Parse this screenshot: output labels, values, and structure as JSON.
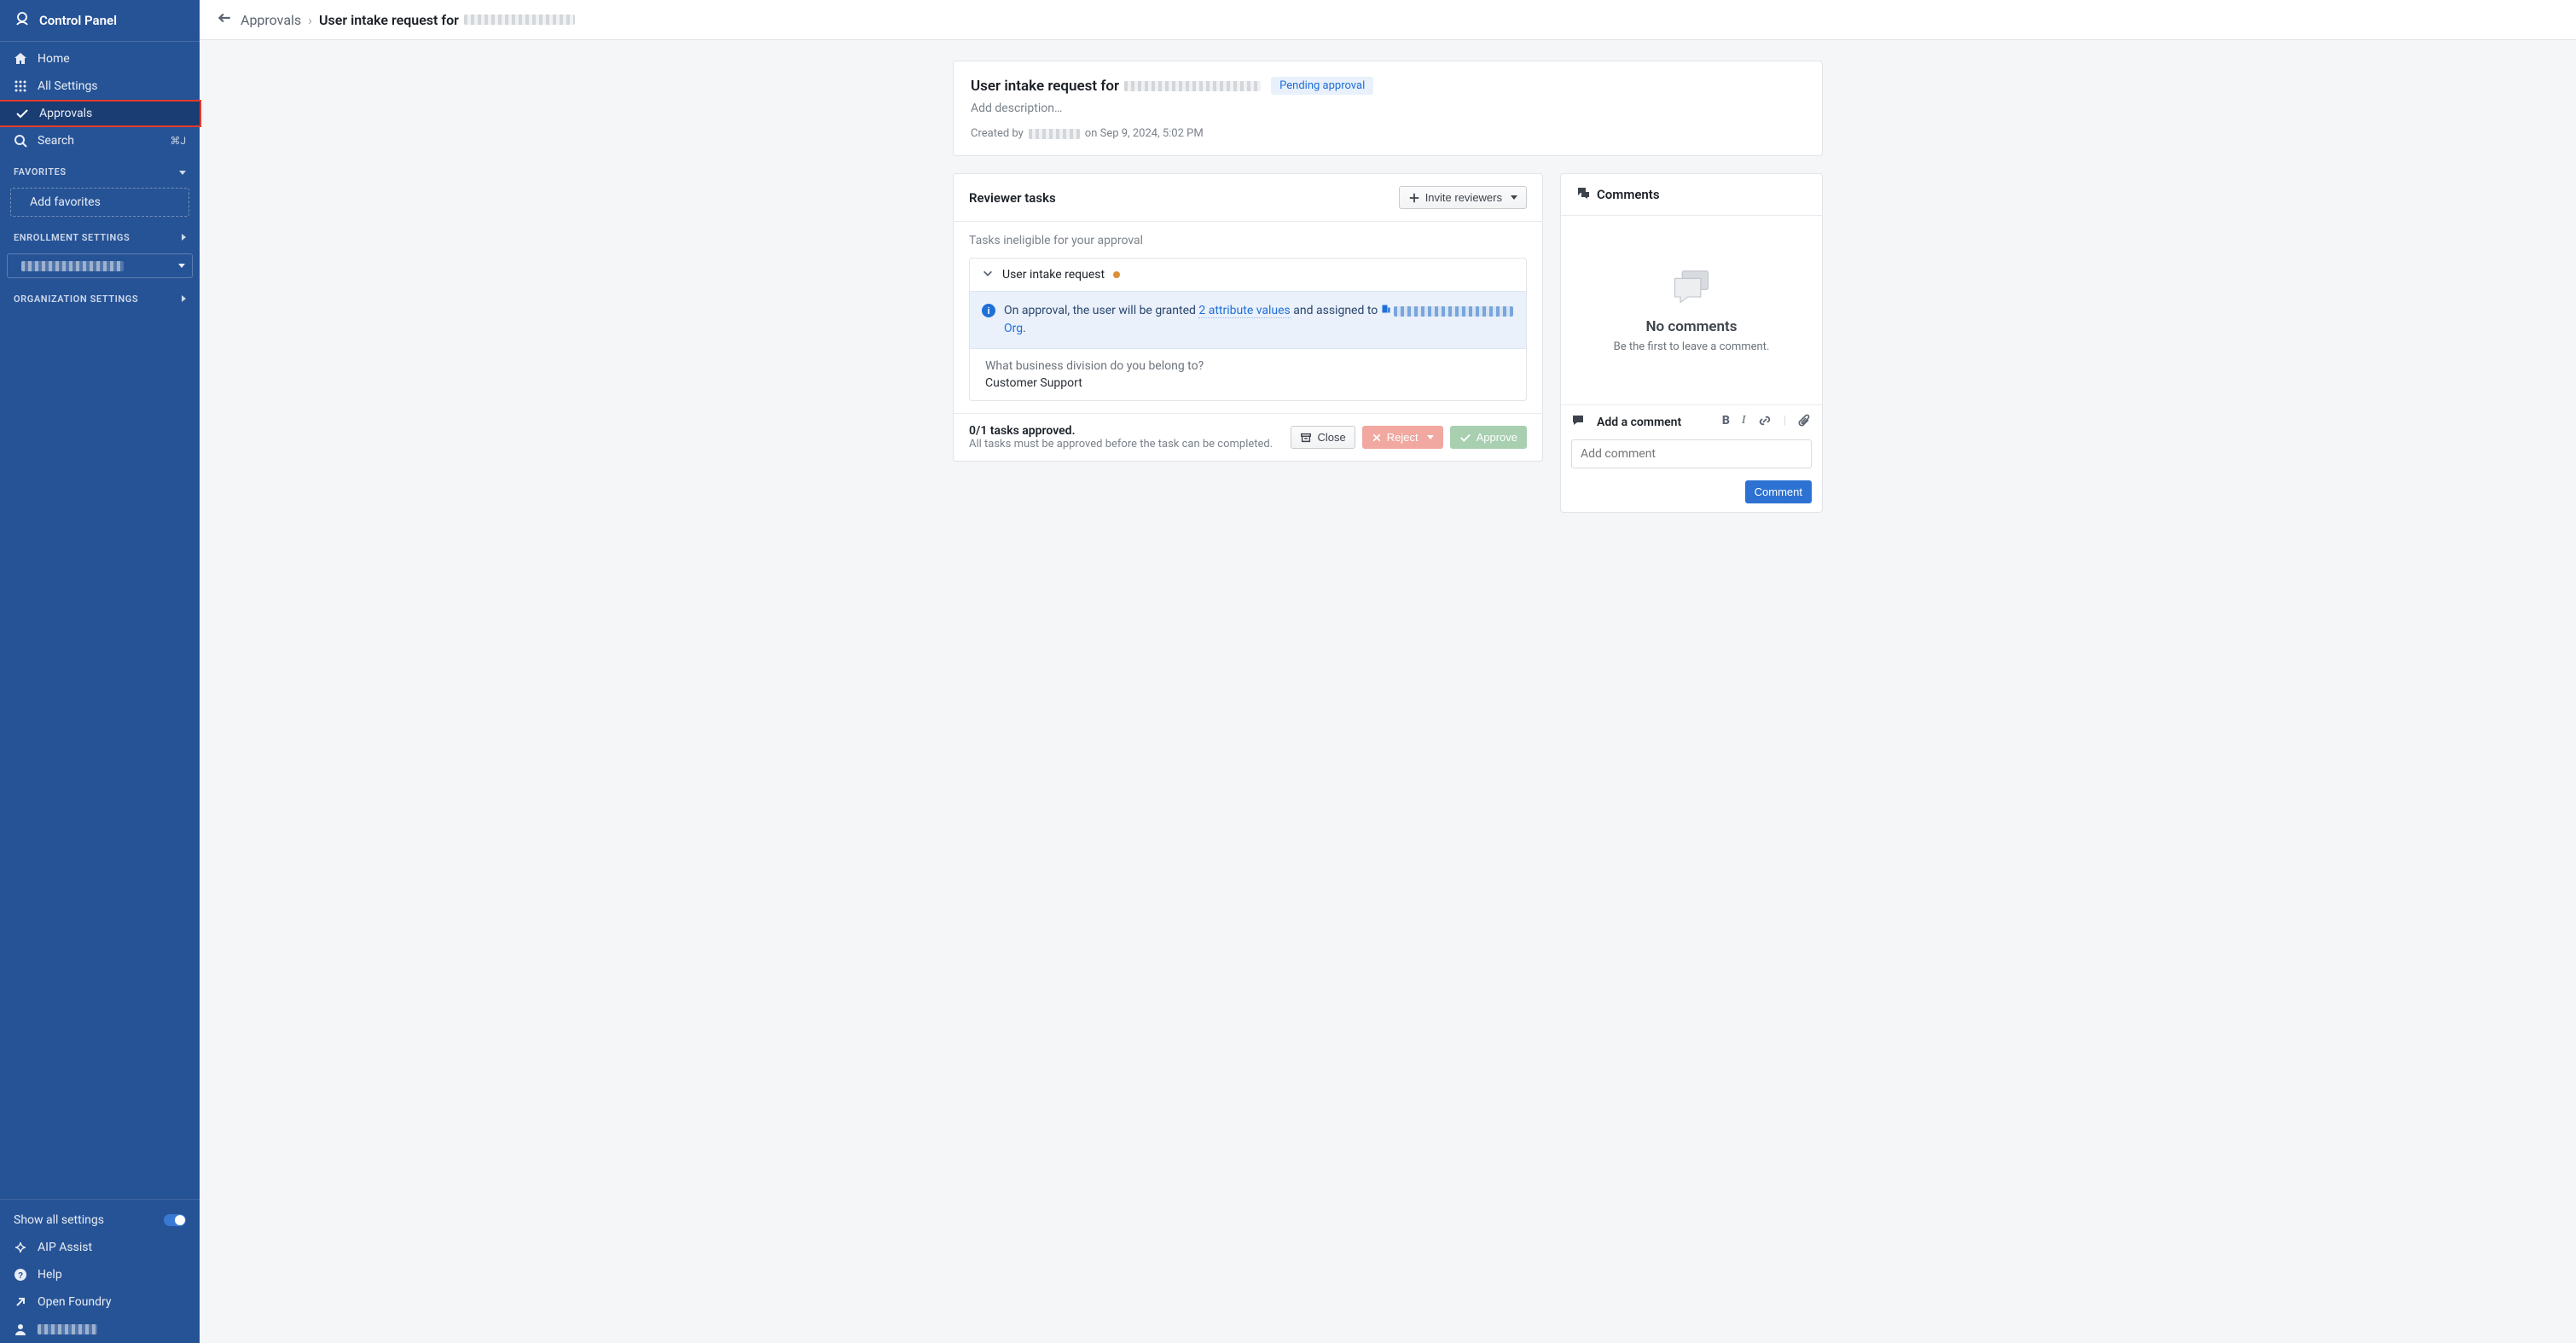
{
  "brand": {
    "title": "Control Panel"
  },
  "nav": {
    "home": "Home",
    "all_settings": "All Settings",
    "approvals": "Approvals",
    "search": "Search",
    "search_shortcut": "⌘J"
  },
  "sections": {
    "favorites": {
      "title": "FAVORITES",
      "add": "Add favorites"
    },
    "enrollment": {
      "title": "ENROLLMENT SETTINGS"
    },
    "organization": {
      "title": "ORGANIZATION SETTINGS"
    }
  },
  "org_selector": {
    "label": "▇▇▇ ▇ ▇▇ ▇▇▇"
  },
  "bottom": {
    "show_all": "Show all settings",
    "aip_assist": "AIP Assist",
    "help": "Help",
    "open_foundry": "Open Foundry"
  },
  "breadcrumb": {
    "approvals": "Approvals",
    "current_prefix": "User intake request for"
  },
  "header": {
    "title_prefix": "User intake request for",
    "badge": "Pending approval",
    "description_placeholder": "Add description…",
    "created_prefix": "Created by",
    "created_suffix": "on Sep 9, 2024, 5:02 PM"
  },
  "reviewer": {
    "title": "Reviewer tasks",
    "invite": "Invite reviewers",
    "ineligible": "Tasks ineligible for your approval",
    "task_title": "User intake request",
    "banner_prefix": "On approval, the user will be granted",
    "banner_link": "2 attribute values",
    "banner_mid": "and assigned to",
    "banner_org_suffix": "Org",
    "question": "What business division do you belong to?",
    "answer": "Customer Support"
  },
  "banner_dot": ".",
  "footer": {
    "status": "0/1 tasks approved.",
    "sub": "All tasks must be approved before the task can be completed.",
    "close": "Close",
    "reject": "Reject",
    "approve": "Approve"
  },
  "comments": {
    "title": "Comments",
    "empty_title": "No comments",
    "empty_sub": "Be the first to leave a comment.",
    "add_label": "Add a comment",
    "placeholder": "Add comment",
    "submit": "Comment"
  }
}
